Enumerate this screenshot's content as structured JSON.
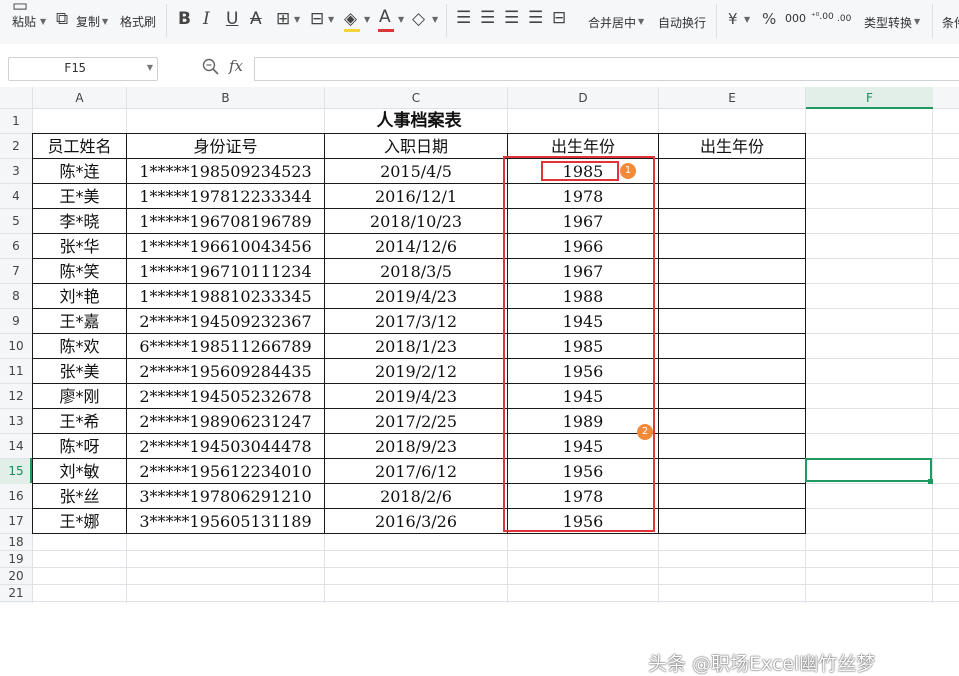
{
  "toolbar": {
    "paste": "粘贴",
    "copy": "复制",
    "format_painter": "格式刷",
    "bold": "B",
    "italic": "I",
    "underline": "U",
    "strike": "A",
    "font_color_glyph": "A",
    "merge_center": "合并居中",
    "wrap_text": "自动换行",
    "currency": "¥",
    "percent": "%",
    "thousands": "000",
    "inc_decimal": "⁺⁰.00",
    "dec_decimal": ".00",
    "type_convert": "类型转换",
    "conditional": "条件"
  },
  "formula_bar": {
    "name_box": "F15",
    "fx_label": "fx",
    "content": ""
  },
  "sheet": {
    "columns": [
      "A",
      "B",
      "C",
      "D",
      "E",
      "F"
    ],
    "selected_column": "F",
    "rows": [
      "1",
      "2",
      "3",
      "4",
      "5",
      "6",
      "7",
      "8",
      "9",
      "10",
      "11",
      "12",
      "13",
      "14",
      "15",
      "16",
      "17",
      "18",
      "19",
      "20",
      "21"
    ],
    "selected_row": "15",
    "title": "人事档案表",
    "headers": [
      "员工姓名",
      "身份证号",
      "入职日期",
      "出生年份",
      "出生年份"
    ],
    "records": [
      {
        "name": "陈*连",
        "id": "1*****198509234523",
        "date": "2015/4/5",
        "year": "1985"
      },
      {
        "name": "王*美",
        "id": "1*****197812233344",
        "date": "2016/12/1",
        "year": "1978"
      },
      {
        "name": "李*晓",
        "id": "1*****196708196789",
        "date": "2018/10/23",
        "year": "1967"
      },
      {
        "name": "张*华",
        "id": "1*****196610043456",
        "date": "2014/12/6",
        "year": "1966"
      },
      {
        "name": "陈*笑",
        "id": "1*****196710111234",
        "date": "2018/3/5",
        "year": "1967"
      },
      {
        "name": "刘*艳",
        "id": "1*****198810233345",
        "date": "2019/4/23",
        "year": "1988"
      },
      {
        "name": "王*嘉",
        "id": "2*****194509232367",
        "date": "2017/3/12",
        "year": "1945"
      },
      {
        "name": "陈*欢",
        "id": "6*****198511266789",
        "date": "2018/1/23",
        "year": "1985"
      },
      {
        "name": "张*美",
        "id": "2*****195609284435",
        "date": "2019/2/12",
        "year": "1956"
      },
      {
        "name": "廖*刚",
        "id": "2*****194505232678",
        "date": "2019/4/23",
        "year": "1945"
      },
      {
        "name": "王*希",
        "id": "2*****198906231247",
        "date": "2017/2/25",
        "year": "1989"
      },
      {
        "name": "陈*呀",
        "id": "2*****194503044478",
        "date": "2018/9/23",
        "year": "1945"
      },
      {
        "name": "刘*敏",
        "id": "2*****195612234010",
        "date": "2017/6/12",
        "year": "1956"
      },
      {
        "name": "张*丝",
        "id": "3*****197806291210",
        "date": "2018/2/6",
        "year": "1978"
      },
      {
        "name": "王*娜",
        "id": "3*****195605131189",
        "date": "2016/3/26",
        "year": "1956"
      }
    ]
  },
  "annotations": {
    "badge_1": "1",
    "badge_2": "2",
    "highlight_color": "#e0343a",
    "badge_color": "#f28a3a"
  },
  "watermark": "头条 @职场Excel幽竹丝梦",
  "colors": {
    "selection": "#1f9960",
    "toolbar_bg": "#f6f7f9"
  }
}
